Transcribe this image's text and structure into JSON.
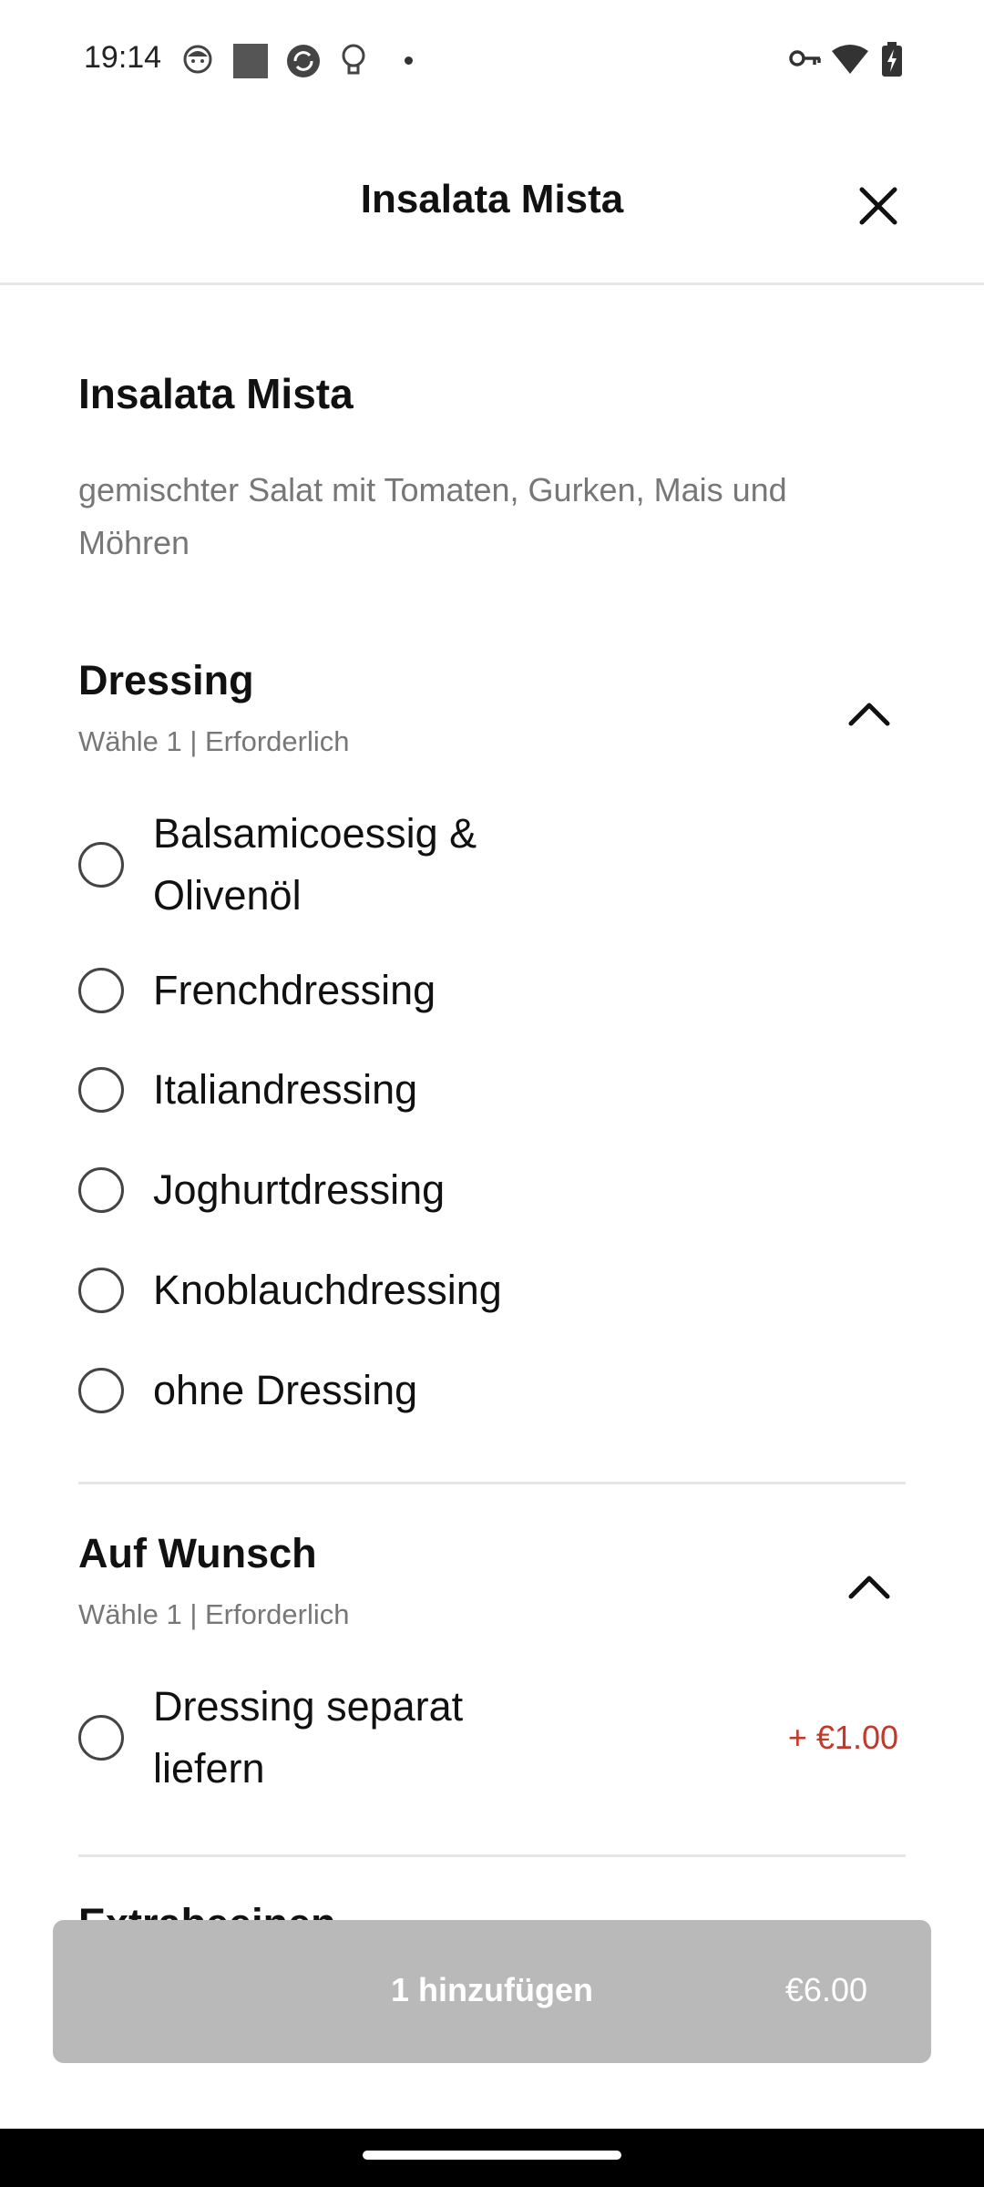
{
  "status_bar": {
    "time": "19:14",
    "left_icons": [
      "face-icon",
      "square-icon",
      "sync-icon",
      "bulb-icon",
      "dot-icon"
    ],
    "right_icons": [
      "key-icon",
      "wifi-icon",
      "battery-charging-icon"
    ]
  },
  "header": {
    "title": "Insalata Mista",
    "close_icon": "close-icon"
  },
  "product": {
    "title": "Insalata Mista",
    "description": "gemischter Salat mit Tomaten, Gurken, Mais und Möhren"
  },
  "sections": [
    {
      "title": "Dressing",
      "subtitle": "Wähle 1  |  Erforderlich",
      "expanded_icon": "chevron-up-icon",
      "options": [
        {
          "label": "Balsamicoessig & Olivenöl",
          "price": "",
          "selected": false
        },
        {
          "label": "Frenchdressing",
          "price": "",
          "selected": false
        },
        {
          "label": "Italiandressing",
          "price": "",
          "selected": false
        },
        {
          "label": "Joghurtdressing",
          "price": "",
          "selected": false
        },
        {
          "label": "Knoblauchdressing",
          "price": "",
          "selected": false
        },
        {
          "label": "ohne Dressing",
          "price": "",
          "selected": false
        }
      ]
    },
    {
      "title": "Auf Wunsch",
      "subtitle": "Wähle 1  |  Erforderlich",
      "expanded_icon": "chevron-up-icon",
      "options": [
        {
          "label": "Dressing separat liefern",
          "price": "+ €1.00",
          "selected": false
        }
      ]
    },
    {
      "title": "Extrabeeinen"
    }
  ],
  "add_button": {
    "label": "1 hinzufügen",
    "price": "€6.00"
  },
  "colors": {
    "price_accent": "#c0392b",
    "button_disabled": "#b9b9b9",
    "divider": "#e6e6e6"
  }
}
